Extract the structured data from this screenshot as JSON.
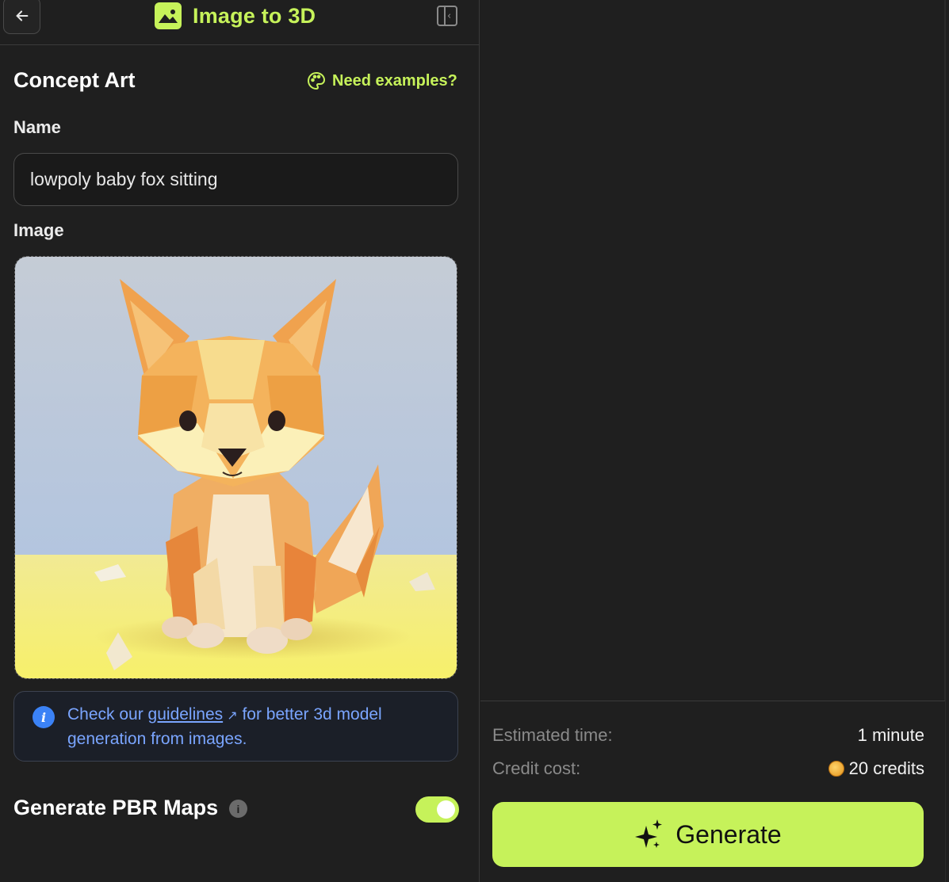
{
  "header": {
    "title": "Image to 3D",
    "back_icon": "arrow-left-icon",
    "title_icon": "image-icon",
    "collapse_icon": "sidebar-collapse-icon"
  },
  "form": {
    "section_title": "Concept Art",
    "examples_link": "Need examples?",
    "examples_icon": "palette-icon",
    "name_label": "Name",
    "name_value": "lowpoly baby fox sitting",
    "image_label": "Image",
    "info": {
      "prefix": "Check our ",
      "link": "guidelines",
      "suffix": " for better 3d model generation from images."
    },
    "pbr_label": "Generate PBR Maps",
    "pbr_enabled": true
  },
  "footer": {
    "time_label": "Estimated time:",
    "time_value": "1 minute",
    "cost_label": "Credit cost:",
    "cost_value": "20 credits",
    "generate_label": "Generate",
    "generate_icon": "sparkles-icon"
  },
  "colors": {
    "accent": "#c6f25a",
    "info": "#7aa5ff",
    "background": "#1f1f1f"
  }
}
